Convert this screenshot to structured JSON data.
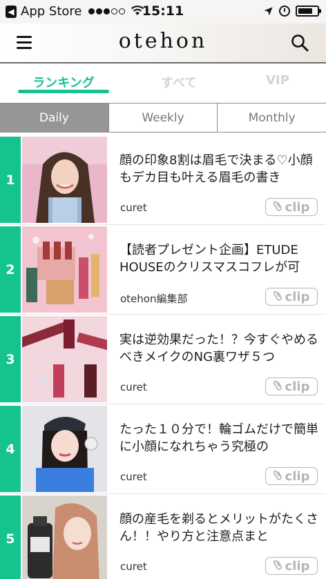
{
  "status_bar": {
    "back_app": "App Store",
    "time": "15:11",
    "battery_level": 0.75
  },
  "header": {
    "logo": "otehon",
    "menu_icon": "hamburger-menu-icon",
    "search_icon": "search-icon"
  },
  "tabs": [
    {
      "label": "ランキング",
      "active": true
    },
    {
      "label": "すべて",
      "active": false
    },
    {
      "label": "VIP",
      "active": false
    }
  ],
  "period": [
    {
      "label": "Daily",
      "active": true
    },
    {
      "label": "Weekly",
      "active": false
    },
    {
      "label": "Monthly",
      "active": false
    }
  ],
  "articles": [
    {
      "rank": "1",
      "title": "顔の印象8割は眉毛で決まる♡小顔もデカ目も叶える眉毛の書き",
      "source": "curet",
      "clip_label": "clip"
    },
    {
      "rank": "2",
      "title": "【読者プレゼント企画】ETUDE HOUSEのクリスマスコフレが可",
      "source": "otehon編集部",
      "clip_label": "clip"
    },
    {
      "rank": "3",
      "title": "実は逆効果だった！？今すぐやめるべきメイクのNG裏ワザ５つ",
      "source": "curet",
      "clip_label": "clip"
    },
    {
      "rank": "4",
      "title": "たった１０分で！輪ゴムだけで簡単に小顔になれちゃう究極の",
      "source": "curet",
      "clip_label": "clip"
    },
    {
      "rank": "5",
      "title": "顔の産毛を剃るとメリットがたくさん！！やり方と注意点まと",
      "source": "curet",
      "clip_label": "clip"
    }
  ],
  "colors": {
    "accent": "#14c38e",
    "segment_active": "#969696",
    "inactive_tab": "#d3d3d3"
  }
}
